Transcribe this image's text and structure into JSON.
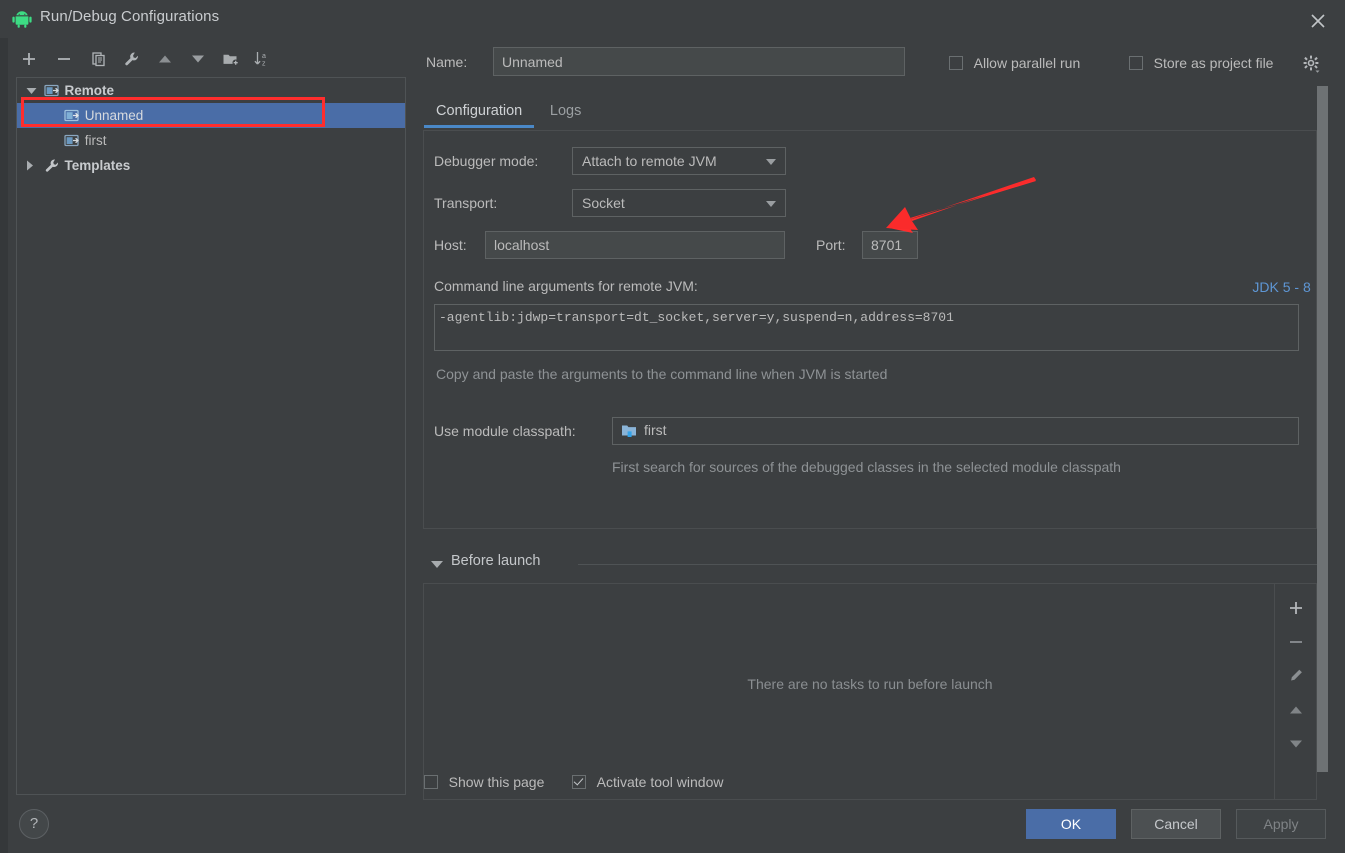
{
  "window": {
    "title": "Run/Debug Configurations",
    "app_icon": "android-robot-icon",
    "close_label": "×"
  },
  "tree_toolbar": {
    "buttons": [
      {
        "name": "add-configuration-button",
        "icon": "plus-icon"
      },
      {
        "name": "remove-configuration-button",
        "icon": "minus-icon"
      },
      {
        "name": "copy-configuration-button",
        "icon": "copy-icon"
      },
      {
        "name": "edit-templates-button",
        "icon": "wrench-icon"
      },
      {
        "name": "move-up-button",
        "icon": "triangle-up-icon"
      },
      {
        "name": "move-down-button",
        "icon": "triangle-down-icon"
      },
      {
        "name": "create-folder-button",
        "icon": "folder-add-icon"
      },
      {
        "name": "sort-configurations-button",
        "icon": "sort-az-icon"
      }
    ]
  },
  "tree": {
    "nodes": [
      {
        "label": "Remote",
        "level": 0,
        "type": "group",
        "expanded": true,
        "icon": "remote-debug-icon",
        "selected": false
      },
      {
        "label": "Unnamed",
        "level": 1,
        "type": "config",
        "expanded": null,
        "icon": "remote-debug-icon",
        "selected": true
      },
      {
        "label": "first",
        "level": 1,
        "type": "config",
        "expanded": null,
        "icon": "remote-debug-icon",
        "selected": false
      },
      {
        "label": "Templates",
        "level": 0,
        "type": "group",
        "expanded": false,
        "icon": "wrench-icon",
        "selected": false
      }
    ]
  },
  "help": {
    "label": "?"
  },
  "header": {
    "name_label": "Name:",
    "name_value": "Unnamed",
    "allow_parallel_run": {
      "label": "Allow parallel run",
      "checked": false
    },
    "store_as_project_file": {
      "label": "Store as project file",
      "checked": false
    },
    "gear_icon": "gear-icon"
  },
  "tabs": [
    {
      "label": "Configuration",
      "active": true
    },
    {
      "label": "Logs",
      "active": false
    }
  ],
  "configuration": {
    "debugger_mode_label": "Debugger mode:",
    "debugger_mode_value": "Attach to remote JVM",
    "transport_label": "Transport:",
    "transport_value": "Socket",
    "host_label": "Host:",
    "host_value": "localhost",
    "port_label": "Port:",
    "port_value": "8701",
    "cmd_label": "Command line arguments for remote JVM:",
    "jdk_link": "JDK 5 - 8",
    "jdk_caret": "⌄",
    "cmd_value": "-agentlib:jdwp=transport=dt_socket,server=y,suspend=n,address=8701",
    "cmd_hint": "Copy and paste the arguments to the command line when JVM is started",
    "module_label": "Use module classpath:",
    "module_value": "first",
    "module_icon": "module-icon",
    "module_hint": "First search for sources of the debugged classes in the selected module classpath"
  },
  "before_launch": {
    "title": "Before launch",
    "expanded": true,
    "empty_message": "There are no tasks to run before launch",
    "actions": [
      {
        "name": "add-task-button",
        "icon": "plus-icon"
      },
      {
        "name": "remove-task-button",
        "icon": "minus-icon"
      },
      {
        "name": "edit-task-button",
        "icon": "pencil-icon"
      },
      {
        "name": "move-task-up-button",
        "icon": "triangle-up-icon"
      },
      {
        "name": "move-task-down-button",
        "icon": "triangle-down-icon"
      }
    ]
  },
  "footer": {
    "show_this_page": {
      "label": "Show this page",
      "checked": false
    },
    "activate_tool_window": {
      "label": "Activate tool window",
      "checked": true
    },
    "ok_label": "OK",
    "cancel_label": "Cancel",
    "apply_label": "Apply"
  },
  "annotations": {
    "highlight_target": "Unnamed",
    "arrow_target": "8701",
    "color": "#ff2d2d"
  },
  "colors": {
    "background": "#3c3f41",
    "field_background": "#45494a",
    "selection": "#4a6da7",
    "accent": "#4a88c7",
    "link": "#5e96d4",
    "text": "#bbbbbb",
    "muted_text": "#8e9295",
    "annotation_red": "#ff2d2d"
  }
}
